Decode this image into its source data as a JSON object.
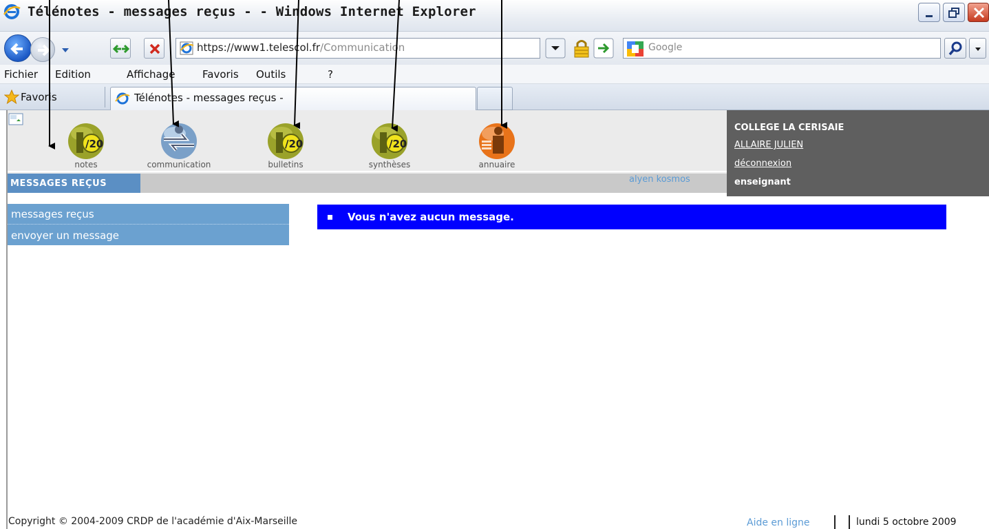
{
  "window": {
    "title": "Télénotes - messages reçus - - Windows Internet Explorer"
  },
  "navigation": {
    "url_host": "https://www1.telescol.fr",
    "url_path": "/Communication",
    "search_provider": "Google"
  },
  "menu": {
    "items": [
      "Fichier",
      "Edition",
      "Affichage",
      "Favoris",
      "Outils",
      "?"
    ]
  },
  "favorites": {
    "label": "Favoris",
    "active_tab": "Télénotes - messages reçus -"
  },
  "app": {
    "modules": [
      {
        "label": "notes",
        "icon": "grade-20-icon",
        "color": "#9aa22a"
      },
      {
        "label": "communication",
        "icon": "communication-arrows-icon",
        "color": "#7aa0c8"
      },
      {
        "label": "bulletins",
        "icon": "grade-20-icon",
        "color": "#9aa22a"
      },
      {
        "label": "synthèses",
        "icon": "grade-20-icon",
        "color": "#9aa22a"
      },
      {
        "label": "annuaire",
        "icon": "directory-person-icon",
        "color": "#e8731a"
      }
    ],
    "section_title": "MESSAGES REÇUS",
    "partner": "alyen kosmos",
    "user": {
      "school": "COLLEGE LA CERISAIE",
      "name": "ALLAIRE JULIEN",
      "logout": "déconnexion",
      "role": "enseignant"
    },
    "side_menu": [
      "messages reçus",
      "envoyer un message"
    ],
    "message": "Vous n'avez aucun message.",
    "footer": {
      "copyright": "Copyright © 2004-2009 CRDP de l'académie d'Aix-Marseille",
      "help": "Aide en ligne",
      "date": "lundi 5 octobre 2009"
    }
  },
  "colors": {
    "accent_blue": "#5b8fc4",
    "message_blue": "#0000ff",
    "user_panel": "#5f5f5f"
  }
}
